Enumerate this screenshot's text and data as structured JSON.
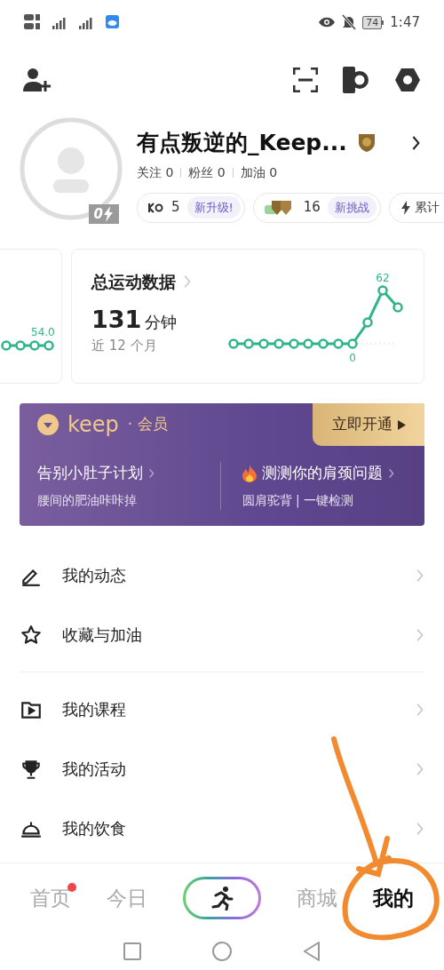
{
  "status_bar": {
    "battery": "74",
    "time": "1:47"
  },
  "profile": {
    "name": "有点叛逆的_Keep...",
    "avatar_badge": "0",
    "stats": [
      {
        "label": "关注",
        "value": "0"
      },
      {
        "label": "粉丝",
        "value": "0"
      },
      {
        "label": "加油",
        "value": "0"
      }
    ],
    "chips": [
      {
        "kind": "level",
        "value": "5",
        "tag": "新升级!"
      },
      {
        "kind": "medal",
        "value": "16",
        "tag": "新挑战"
      },
      {
        "kind": "total",
        "label": "累计"
      }
    ]
  },
  "cards": [
    {
      "kind": "partial",
      "reading": "54.0"
    },
    {
      "kind": "total",
      "title": "总运动数据",
      "value": "131",
      "unit": "分钟",
      "period": "近 12 个月",
      "peak": "62",
      "base": "0"
    }
  ],
  "member": {
    "brand": "keep",
    "suffix": "· 会员",
    "button": "立即开通",
    "promos": [
      {
        "title": "告别小肚子计划",
        "subtitle": "腰间的肥油咔咔掉",
        "hot": false
      },
      {
        "title": "测测你的肩颈问题",
        "subtitle": "圆肩驼背 | 一键检测",
        "hot": true
      }
    ]
  },
  "menu": [
    [
      {
        "kind": "pen",
        "label": "我的动态"
      },
      {
        "kind": "star",
        "label": "收藏与加油"
      }
    ],
    [
      {
        "kind": "play",
        "label": "我的课程"
      },
      {
        "kind": "trophy",
        "label": "我的活动"
      },
      {
        "kind": "cloche",
        "label": "我的饮食"
      }
    ]
  ],
  "nav": [
    {
      "kind": "text",
      "label": "首页",
      "selected": false,
      "dot": true
    },
    {
      "kind": "text",
      "label": "今日",
      "selected": false,
      "dot": false
    },
    {
      "kind": "run"
    },
    {
      "kind": "text",
      "label": "商城",
      "selected": false,
      "dot": false
    },
    {
      "kind": "text",
      "label": "我的",
      "selected": true,
      "dot": false
    }
  ]
}
